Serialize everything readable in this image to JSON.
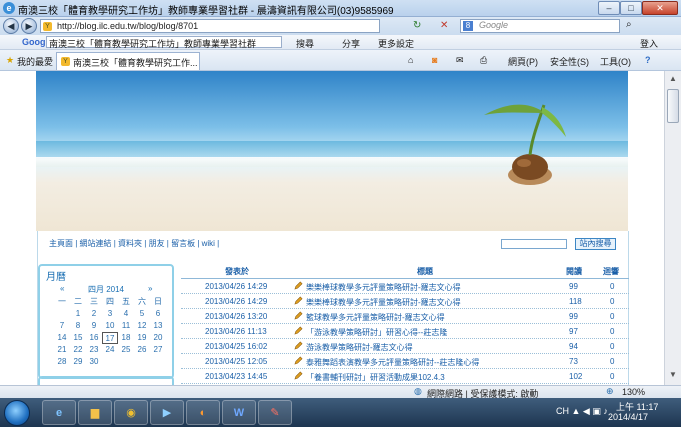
{
  "window": {
    "title": "南澳三校「體育教學研究工作坊」教師專業學習社群 - 晨濤資訊有限公司(03)9585969",
    "minimize": "–",
    "maximize": "□",
    "close": "✕"
  },
  "addressbar": {
    "back": "◀",
    "forward": "▶",
    "url": "http://blog.ilc.edu.tw/blog/blog/8701",
    "refresh": "↻",
    "stop": "✕",
    "search_placeholder": "Google"
  },
  "google_toolbar": {
    "logo": "Google",
    "input_value": "南澳三校「體育教學研究工作坊」教師專業學習社群",
    "search": "搜尋",
    "share": "分享",
    "more": "更多設定",
    "login": "登入"
  },
  "favorites_bar": {
    "favorites": "我的最愛",
    "tab_label": "南澳三校「體育教學研究工作...",
    "page_menu": "網頁(P)",
    "safety_menu": "安全性(S)",
    "tools_menu": "工具(O)",
    "help": "?"
  },
  "page": {
    "nav_links": "主頁面 | 網站連結 | 資料夾 | 朋友 | 留言板 | wiki |",
    "search_button": "站內搜尋",
    "calendar": {
      "title": "月曆",
      "month": "四月 2014",
      "prev": "«",
      "next": "»",
      "weekdays": [
        "一",
        "二",
        "三",
        "四",
        "五",
        "六",
        "日"
      ],
      "weeks": [
        [
          "",
          "1",
          "2",
          "3",
          "4",
          "5",
          "6"
        ],
        [
          "7",
          "8",
          "9",
          "10",
          "11",
          "12",
          "13"
        ],
        [
          "14",
          "15",
          "16",
          "17",
          "18",
          "19",
          "20"
        ],
        [
          "21",
          "22",
          "23",
          "24",
          "25",
          "26",
          "27"
        ],
        [
          "28",
          "29",
          "30",
          "",
          "",
          "",
          ""
        ]
      ],
      "today": "17"
    },
    "table": {
      "headers": {
        "date": "發表於",
        "title": "標題",
        "views": "閱讀",
        "replies": "迴響"
      },
      "rows": [
        {
          "date": "2013/04/26 14:29",
          "title": "樂樂棒球教學多元評量策略研討-羅志文心得",
          "views": "99",
          "replies": "0"
        },
        {
          "date": "2013/04/26 14:29",
          "title": "樂樂棒球教學多元評量策略研討-羅志文心得",
          "views": "118",
          "replies": "0"
        },
        {
          "date": "2013/04/26 13:20",
          "title": "籃球教學多元評量策略研討-羅志文心得",
          "views": "99",
          "replies": "0"
        },
        {
          "date": "2013/04/26 11:13",
          "title": "「游泳教學策略研討」研習心得--莊志隆",
          "views": "97",
          "replies": "0"
        },
        {
          "date": "2013/04/25 16:02",
          "title": "游泳教學策略研討-羅志文心得",
          "views": "94",
          "replies": "0"
        },
        {
          "date": "2013/04/25 12:05",
          "title": "泰雅舞蹈表演教學多元評量策略研討--莊志隆心得",
          "views": "73",
          "replies": "0"
        },
        {
          "date": "2013/04/23 14:45",
          "title": "「養書輔刊研討」研習活動成果102.4.3",
          "views": "102",
          "replies": "0"
        }
      ]
    }
  },
  "statusbar": {
    "zone": "網際網路 | 受保護模式: 啟動",
    "zoom": "130%"
  },
  "taskbar": {
    "time": "上午 11:17",
    "date": "2014/4/17",
    "tray": "CH ▲ ◀ ▣ ♪"
  },
  "colors": {
    "link": "#1a5fa8",
    "calendar_border": "#8fd0e8"
  }
}
